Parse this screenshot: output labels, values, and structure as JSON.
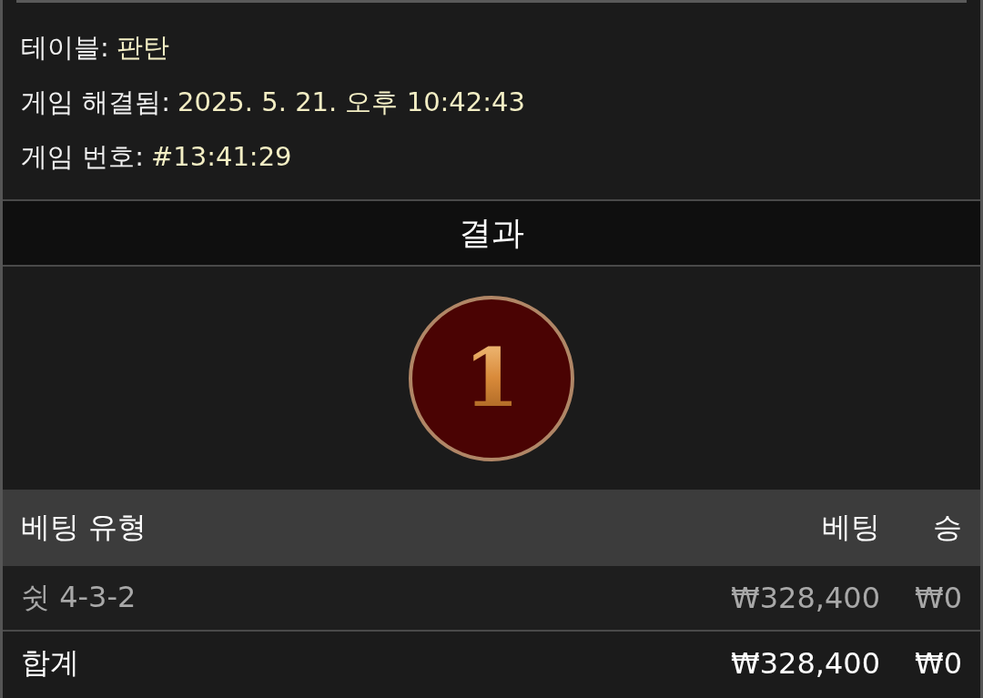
{
  "info": [
    {
      "label": "테이블:",
      "value": "판탄"
    },
    {
      "label": "게임 해결됨:",
      "value": "2025. 5. 21. 오후 10:42:43"
    },
    {
      "label": "게임 번호:",
      "value": "#13:41:29"
    }
  ],
  "result": {
    "title": "결과",
    "number": "1"
  },
  "table": {
    "columns": [
      "베팅 유형",
      "베팅",
      "승"
    ],
    "rows": [
      {
        "kind": "bet",
        "cells": [
          "쉿 4-3-2",
          "₩328,400",
          "₩0"
        ]
      },
      {
        "kind": "total",
        "cells": [
          "합계",
          "₩328,400",
          "₩0"
        ]
      }
    ]
  }
}
